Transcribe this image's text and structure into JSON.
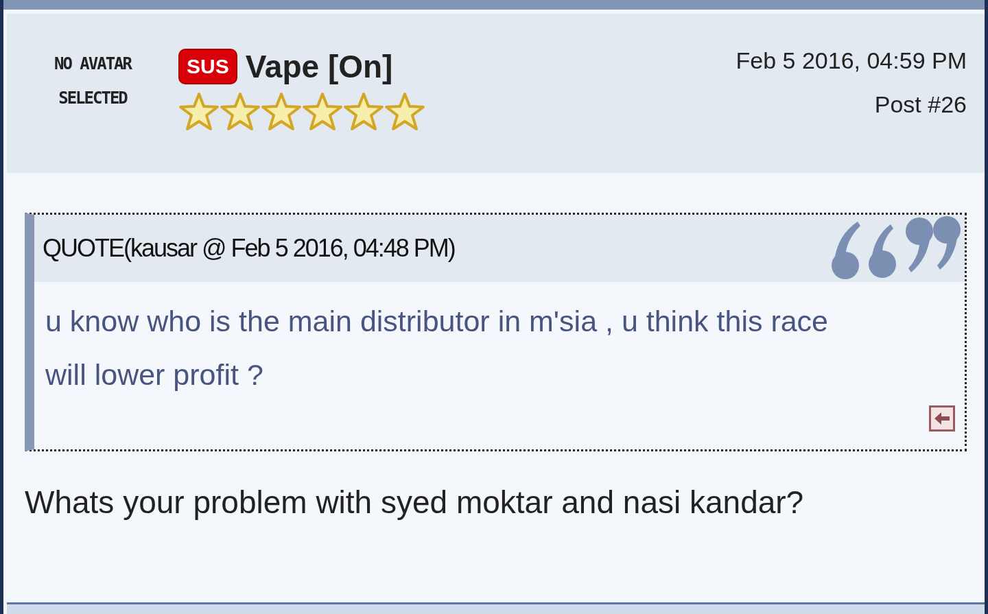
{
  "post": {
    "avatar_text": "NO AVATAR SELECTED",
    "badge": "SUS",
    "username": "Vape [On]",
    "stars": 6,
    "date": "Feb 5 2016, 04:59 PM",
    "post_number": "Post #26"
  },
  "quote": {
    "header": "QUOTE(kausar @ Feb 5 2016, 04:48 PM)",
    "text": "u know who is the main distributor in m'sia , u think this race will lower profit ?"
  },
  "message": "Whats your problem with syed moktar and nasi kandar?"
}
